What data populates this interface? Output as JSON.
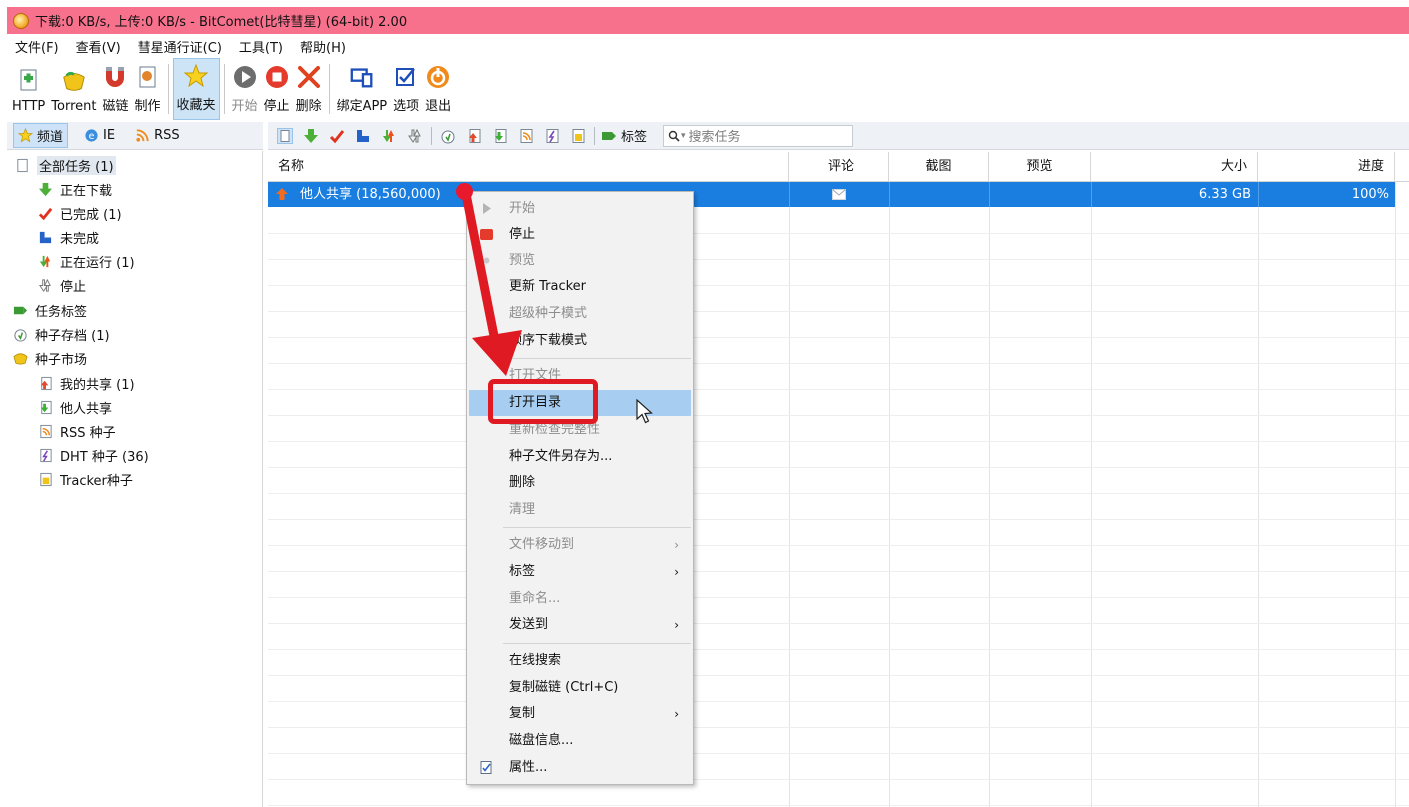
{
  "window": {
    "title": "下载:0 KB/s, 上传:0 KB/s - BitComet(比特彗星) (64-bit) 2.00"
  },
  "menubar": [
    "文件(F)",
    "查看(V)",
    "彗星通行证(C)",
    "工具(T)",
    "帮助(H)"
  ],
  "toolbar": {
    "http": "HTTP",
    "torrent": "Torrent",
    "magnet": "磁链",
    "make": "制作",
    "favorites": "收藏夹",
    "start": "开始",
    "stop": "停止",
    "delete": "删除",
    "bind_app": "绑定APP",
    "options": "选项",
    "exit": "退出"
  },
  "left_tabs": {
    "channel": "频道",
    "ie": "IE",
    "rss": "RSS"
  },
  "tree": {
    "all_tasks": "全部任务 (1)",
    "downloading": "正在下载",
    "completed": "已完成 (1)",
    "incomplete": "未完成",
    "running": "正在运行 (1)",
    "stopped": "停止",
    "task_tags": "任务标签",
    "torrent_archive": "种子存档 (1)",
    "torrent_market": "种子市场",
    "my_shares": "我的共享 (1)",
    "others_shares": "他人共享",
    "rss_seeds": "RSS 种子",
    "dht_seeds": "DHT 种子 (36)",
    "tracker_seeds": "Tracker种子"
  },
  "task_toolbar": {
    "tag_label": "标签",
    "search_placeholder": "搜索任务"
  },
  "table": {
    "headers": {
      "name": "名称",
      "comment": "评论",
      "screenshot": "截图",
      "preview": "预览",
      "size": "大小",
      "progress": "进度"
    },
    "row": {
      "name": "他人共享 (18,560,000)",
      "size": "6.33 GB",
      "progress": "100%"
    }
  },
  "context_menu": {
    "start": "开始",
    "stop": "停止",
    "preview": "预览",
    "update_tracker": "更新 Tracker",
    "super_seed": "超级种子模式",
    "sequential": "顺序下载模式",
    "open_file": "打开文件",
    "open_dir": "打开目录",
    "recheck": "重新检查完整性",
    "save_torrent": "种子文件另存为...",
    "delete": "删除",
    "clean": "清理",
    "move_files": "文件移动到",
    "tags": "标签",
    "rename": "重命名...",
    "send_to": "发送到",
    "online_search": "在线搜索",
    "copy_magnet": "复制磁链 (Ctrl+C)",
    "copy": "复制",
    "disk_info": "磁盘信息...",
    "properties": "属性..."
  },
  "colors": {
    "titlebar": "#f7718d",
    "selection": "#1a7ee0",
    "menu_highlight": "#a7cdf0",
    "annotation_red": "#e01a22"
  }
}
